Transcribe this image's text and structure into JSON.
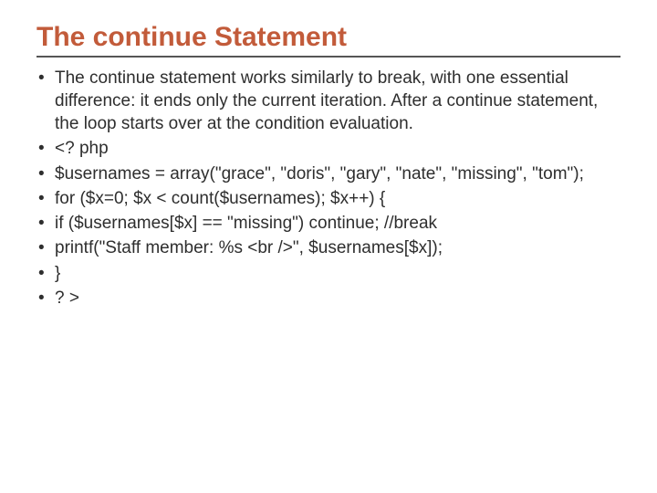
{
  "title": "The continue Statement",
  "bullets": [
    "The continue statement works similarly to break, with one essential difference: it ends only the current iteration. After a continue statement, the loop starts over at the condition evaluation.",
    "<? php",
    "$usernames = array(\"grace\", \"doris\", \"gary\", \"nate\", \"missing\", \"tom\");",
    "for ($x=0; $x < count($usernames); $x++) {",
    "if ($usernames[$x] == \"missing\") continue; //break",
    "printf(\"Staff member: %s <br />\", $usernames[$x]);",
    "}",
    "? >"
  ]
}
